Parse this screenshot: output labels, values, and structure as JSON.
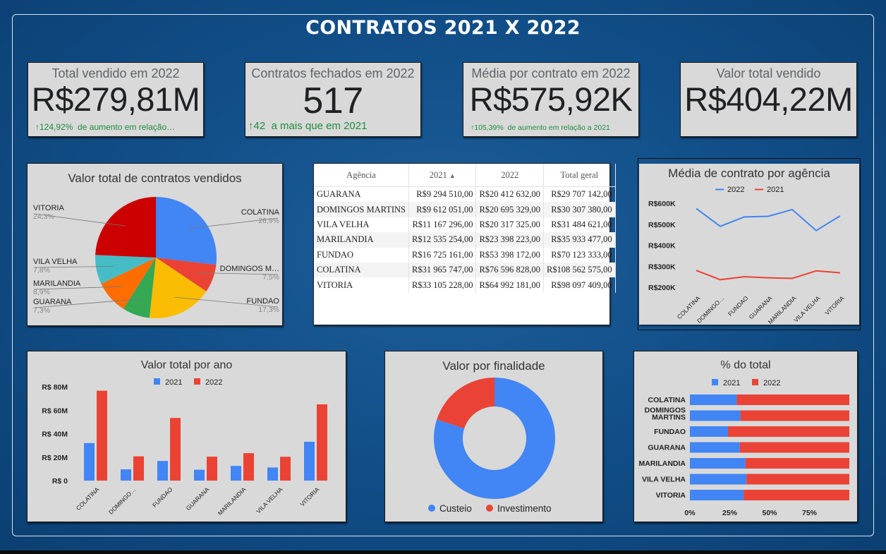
{
  "page_title": "CONTRATOS 2021 X 2022",
  "colors": {
    "series_2021": "#4285f4",
    "series_2022": "#ea4335",
    "positive": "#1e8e3e"
  },
  "kpis": [
    {
      "label": "Total vendido em 2022",
      "value": "R$279,81M",
      "delta_value": "124,92%",
      "delta_text": "de aumento em relação…"
    },
    {
      "label": "Contratos fechados em 2022",
      "value": "517",
      "delta_value": "42",
      "delta_text": "a mais que em 2021"
    },
    {
      "label": "Média por contrato em 2022",
      "value": "R$575,92K",
      "delta_value": "105,39%",
      "delta_text": "de aumento em relação a 2021"
    },
    {
      "label": "Valor total vendido",
      "value": "R$404,22M"
    }
  ],
  "table": {
    "headers": [
      "Agência",
      "2021",
      "2022",
      "Total geral"
    ],
    "sort_icon": "sort-asc-icon",
    "rows": [
      [
        "GUARANA",
        "R$9 294 510,00",
        "R$20 412 632,00",
        "R$29 707 142,00"
      ],
      [
        "DOMINGOS MARTINS",
        "R$9 612 051,00",
        "R$20 695 329,00",
        "R$30 307 380,00"
      ],
      [
        "VILA VELHA",
        "R$11 167 296,00",
        "R$20 317 325,00",
        "R$31 484 621,00"
      ],
      [
        "MARILANDIA",
        "R$12 535 254,00",
        "R$23 398 223,00",
        "R$35 933 477,00"
      ],
      [
        "FUNDAO",
        "R$16 725 161,00",
        "R$53 398 172,00",
        "R$70 123 333,00"
      ],
      [
        "COLATINA",
        "R$31 965 747,00",
        "R$76 596 828,00",
        "R$108 562 575,00"
      ],
      [
        "VITORIA",
        "R$33 105 228,00",
        "R$64 992 181,00",
        "R$98 097 409,00"
      ]
    ]
  },
  "chart_data": [
    {
      "type": "pie",
      "title": "Valor total de contratos vendidos",
      "labels": [
        "COLATINA",
        "DOMINGOS M…",
        "FUNDAO",
        "GUARANA",
        "MARILANDIA",
        "VILA VELHA",
        "VITORIA"
      ],
      "display_pcts": [
        "26,9%",
        "7,5%",
        "17,3%",
        "7,3%",
        "8,9%",
        "7,8%",
        "24,3%"
      ],
      "values": [
        26.9,
        7.5,
        17.3,
        7.3,
        8.9,
        7.8,
        24.3
      ],
      "colors": [
        "#4285f4",
        "#ea4335",
        "#fbbc04",
        "#34a853",
        "#ff6d01",
        "#46bdc6",
        "#cc0000"
      ]
    },
    {
      "type": "line",
      "title": "Média de contrato por agência",
      "categories": [
        "COLATINA",
        "DOMINGO…",
        "FUNDAO",
        "GUARANA",
        "MARILANDIA",
        "VILA VELHA",
        "VITORIA"
      ],
      "series": [
        {
          "name": "2022",
          "color": "#4285f4",
          "values": [
            575000,
            490000,
            535000,
            538000,
            570000,
            470000,
            540000
          ]
        },
        {
          "name": "2021",
          "color": "#ea4335",
          "values": [
            280000,
            236000,
            250000,
            245000,
            242000,
            278000,
            269000
          ]
        }
      ],
      "yticks": [
        "R$200K",
        "R$300K",
        "R$400K",
        "R$500K",
        "R$600K"
      ],
      "ylim": [
        200000,
        600000
      ],
      "legend": "top"
    },
    {
      "type": "bar",
      "title": "Valor total por ano",
      "categories": [
        "COLATINA",
        "DOMINGO…",
        "FUNDAO",
        "GUARANA",
        "MARILANDIA",
        "VILA VELHA",
        "VITORIA"
      ],
      "series": [
        {
          "name": "2021",
          "color": "#4285f4",
          "values": [
            31965747,
            9612051,
            16725161,
            9294510,
            12535254,
            11167296,
            33105228
          ]
        },
        {
          "name": "2022",
          "color": "#ea4335",
          "values": [
            76596828,
            20695329,
            53398172,
            20412632,
            23398223,
            20317325,
            64992181
          ]
        }
      ],
      "yticks": [
        "R$ 0",
        "R$ 20M",
        "R$ 40M",
        "R$ 60M",
        "R$ 80M"
      ],
      "ylim": [
        0,
        80000000
      ],
      "legend": "top"
    },
    {
      "type": "pie",
      "donut": true,
      "title": "Valor por finalidade",
      "labels": [
        "Custeio",
        "Investimento"
      ],
      "values": [
        80,
        20
      ],
      "colors": [
        "#4285f4",
        "#ea4335"
      ],
      "legend": "bottom"
    },
    {
      "type": "bar",
      "stacked_percent": true,
      "orientation": "horizontal",
      "title": "% do total",
      "categories": [
        "COLATINA",
        "DOMINGOS MARTINS",
        "FUNDAO",
        "GUARANA",
        "MARILANDIA",
        "VILA VELHA",
        "VITORIA"
      ],
      "series": [
        {
          "name": "2021",
          "color": "#4285f4",
          "values": [
            29.4,
            31.7,
            23.9,
            31.3,
            34.9,
            35.5,
            33.7
          ]
        },
        {
          "name": "2022",
          "color": "#ea4335",
          "values": [
            70.6,
            68.3,
            76.1,
            68.7,
            65.1,
            64.5,
            66.3
          ]
        }
      ],
      "xticks": [
        "0%",
        "25%",
        "50%",
        "75%"
      ],
      "legend": "top"
    }
  ]
}
